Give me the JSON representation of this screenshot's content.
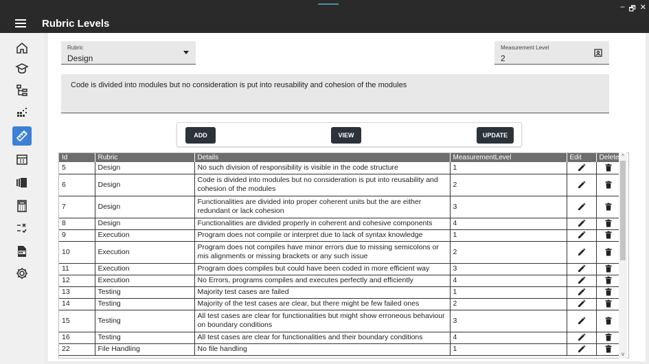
{
  "header": {
    "title": "Rubric Levels",
    "window_controls": [
      "–",
      "🗗",
      "✕"
    ]
  },
  "form": {
    "rubric_label": "Rubric",
    "rubric_value": "Design",
    "level_label": "Measurement Level",
    "level_value": "2",
    "details_value": "Code is divided into modules but no consideration is put into reusability and cohesion of the modules"
  },
  "buttons": {
    "add": "ADD",
    "view": "VIEW",
    "update": "UPDATE"
  },
  "table": {
    "columns": [
      "Id",
      "Rubric",
      "Details",
      "MeasurementLevel",
      "Edit",
      "Delete"
    ],
    "rows": [
      {
        "id": "5",
        "rubric": "Design",
        "details": "No such division of responsibility is visible in the code structure",
        "level": "1"
      },
      {
        "id": "6",
        "rubric": "Design",
        "details": "Code is divided into modules but no consideration is put into reusability and cohesion of the modules",
        "level": "2"
      },
      {
        "id": "7",
        "rubric": "Design",
        "details": "Functionalities are divided into proper coherent units but the are either redundant or lack cohesion",
        "level": "3"
      },
      {
        "id": "8",
        "rubric": "Design",
        "details": "Functionalities are divided properly in coherent and cohesive components",
        "level": "4"
      },
      {
        "id": "9",
        "rubric": "Execution",
        "details": "Program does not compile or interpret due to lack of syntax knowledge",
        "level": "1"
      },
      {
        "id": "10",
        "rubric": "Execution",
        "details": "Program does not compiles have minor errors due to missing semicolons or mis alignments or missing brackets or any such issue",
        "level": "2"
      },
      {
        "id": "11",
        "rubric": "Execution",
        "details": "Program does compiles but could have been coded in more efficient way",
        "level": "3"
      },
      {
        "id": "12",
        "rubric": "Execution",
        "details": "No Errors, programs compiles and executes perfectly and efficiently",
        "level": "4"
      },
      {
        "id": "13",
        "rubric": "Testing",
        "details": "Majority test cases are failed",
        "level": "1"
      },
      {
        "id": "14",
        "rubric": "Testing",
        "details": "Majority of the test cases are clear, but there might be few failed ones",
        "level": "2"
      },
      {
        "id": "15",
        "rubric": "Testing",
        "details": "All test cases are clear for functionalities but might show erroneous behaviour on boundary conditions",
        "level": "3"
      },
      {
        "id": "16",
        "rubric": "Testing",
        "details": "All test cases are clear for functionalities and their boundary conditions",
        "level": "4"
      },
      {
        "id": "22",
        "rubric": "File Handling",
        "details": "No file handling",
        "level": "1"
      }
    ]
  },
  "sidebar": {
    "items": [
      {
        "icon": "home-icon",
        "active": false
      },
      {
        "icon": "graduation-cap-icon",
        "active": false
      },
      {
        "icon": "hierarchy-icon",
        "active": false
      },
      {
        "icon": "scatter-icon",
        "active": false
      },
      {
        "icon": "ruler-icon",
        "active": true
      },
      {
        "icon": "calendar-icon",
        "active": false
      },
      {
        "icon": "cards-icon",
        "active": false
      },
      {
        "icon": "calculator-icon",
        "active": false
      },
      {
        "icon": "checklist-icon",
        "active": false
      },
      {
        "icon": "pdf-icon",
        "active": false
      },
      {
        "icon": "gear-icon",
        "active": false
      }
    ]
  }
}
